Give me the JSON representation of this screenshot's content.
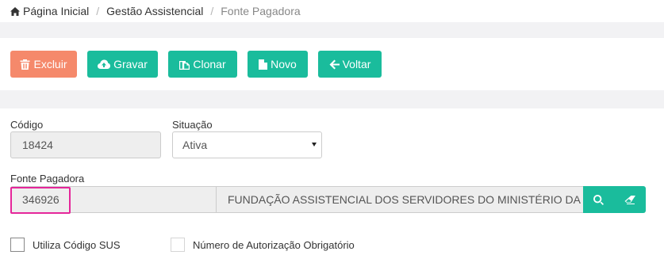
{
  "breadcrumb": {
    "home": "Página Inicial",
    "section": "Gestão Assistencial",
    "current": "Fonte Pagadora",
    "separator": "/"
  },
  "toolbar": {
    "excluir": "Excluir",
    "gravar": "Gravar",
    "clonar": "Clonar",
    "novo": "Novo",
    "voltar": "Voltar"
  },
  "form": {
    "codigo_label": "Código",
    "codigo_value": "18424",
    "situacao_label": "Situação",
    "situacao_value": "Ativa",
    "fonte_label": "Fonte Pagadora",
    "fonte_code": "346926",
    "fonte_name": "FUNDAÇÃO ASSISTENCIAL DOS SERVIDORES DO MINISTÉRIO DA FAZ",
    "utiliza_sus_label": "Utiliza Código SUS",
    "num_autorizacao_label": "Número de Autorização Obrigatório"
  },
  "colors": {
    "primary": "#1abc9c",
    "danger": "#f5896b",
    "highlight": "#e5269a"
  },
  "icons": {
    "home": "home-icon",
    "excluir": "trash-icon",
    "gravar": "cloud-upload-icon",
    "clonar": "copy-icon",
    "novo": "file-icon",
    "voltar": "arrow-left-icon",
    "search": "search-icon",
    "clear": "eraser-icon"
  }
}
